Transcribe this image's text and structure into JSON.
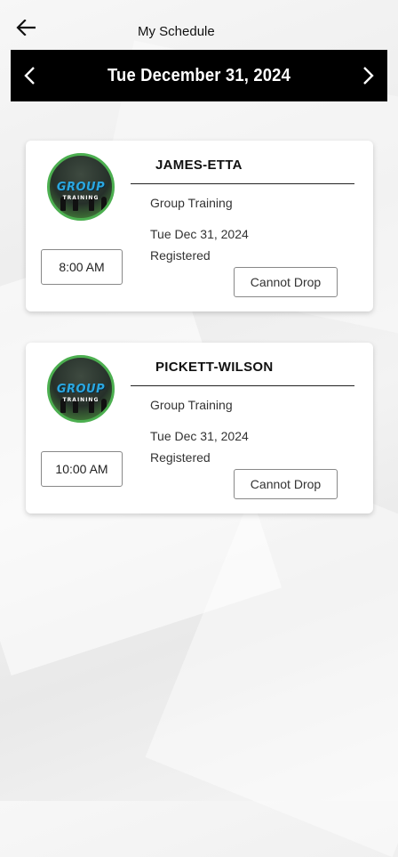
{
  "header": {
    "title": "My Schedule",
    "back_icon": "arrow-left-icon"
  },
  "date_bar": {
    "date": "Tue December 31, 2024",
    "prev_icon": "chevron-left-icon",
    "next_icon": "chevron-right-icon"
  },
  "colors": {
    "date_bar_bg": "#000000",
    "avatar_ring": "#4caf50"
  },
  "sessions": [
    {
      "name": "JAMES-ETTA",
      "type": "Group Training",
      "date": "Tue Dec 31, 2024",
      "status": "Registered",
      "time": "8:00 AM",
      "action": "Cannot Drop",
      "logo_line1": "GROUP",
      "logo_line2": "TRAINING"
    },
    {
      "name": "PICKETT-WILSON",
      "type": "Group Training",
      "date": "Tue Dec 31, 2024",
      "status": "Registered",
      "time": "10:00 AM",
      "action": "Cannot Drop",
      "logo_line1": "GROUP",
      "logo_line2": "TRAINING"
    }
  ]
}
